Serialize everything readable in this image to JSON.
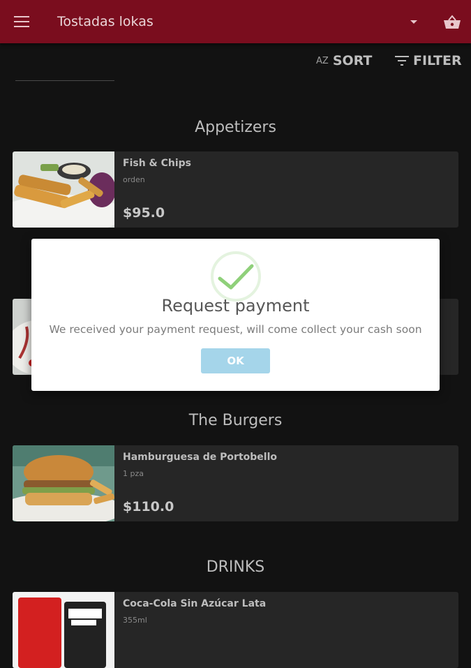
{
  "app_bar": {
    "title": "Tostadas lokas",
    "menu_icon": "menu-icon",
    "dropdown_icon": "dropdown-arrow-icon",
    "basket_icon": "basket-icon"
  },
  "toolbar": {
    "sort_icon_text": "AZ",
    "sort_label": "SORT",
    "filter_label": "FILTER"
  },
  "sections": [
    {
      "title": "Appetizers",
      "items": [
        {
          "name": "Fish & Chips",
          "description": "orden",
          "price": "$95.0",
          "image": "fish-and-chips"
        }
      ]
    },
    {
      "title": "",
      "items": [
        {
          "name": "",
          "description": "",
          "price": "",
          "image": "dish-partially-hidden"
        }
      ]
    },
    {
      "title": "The Burgers",
      "items": [
        {
          "name": "Hamburguesa de Portobello",
          "description": "1 pza",
          "price": "$110.0",
          "image": "burger"
        }
      ]
    },
    {
      "title": "DRINKS",
      "items": [
        {
          "name": "Coca-Cola Sin Azúcar Lata",
          "description": "355ml",
          "price": "",
          "image": "coca-cola-can"
        }
      ]
    }
  ],
  "dialog": {
    "title": "Request payment",
    "message": "We received your payment request, will come collect your cash soon",
    "ok_label": "OK",
    "icon": "success-check-icon"
  },
  "colors": {
    "app_bar": "#7a0d1e",
    "background": "#121212",
    "card": "#262626",
    "ok_button": "#a5d5ea",
    "success_check": "#8fd07a"
  }
}
